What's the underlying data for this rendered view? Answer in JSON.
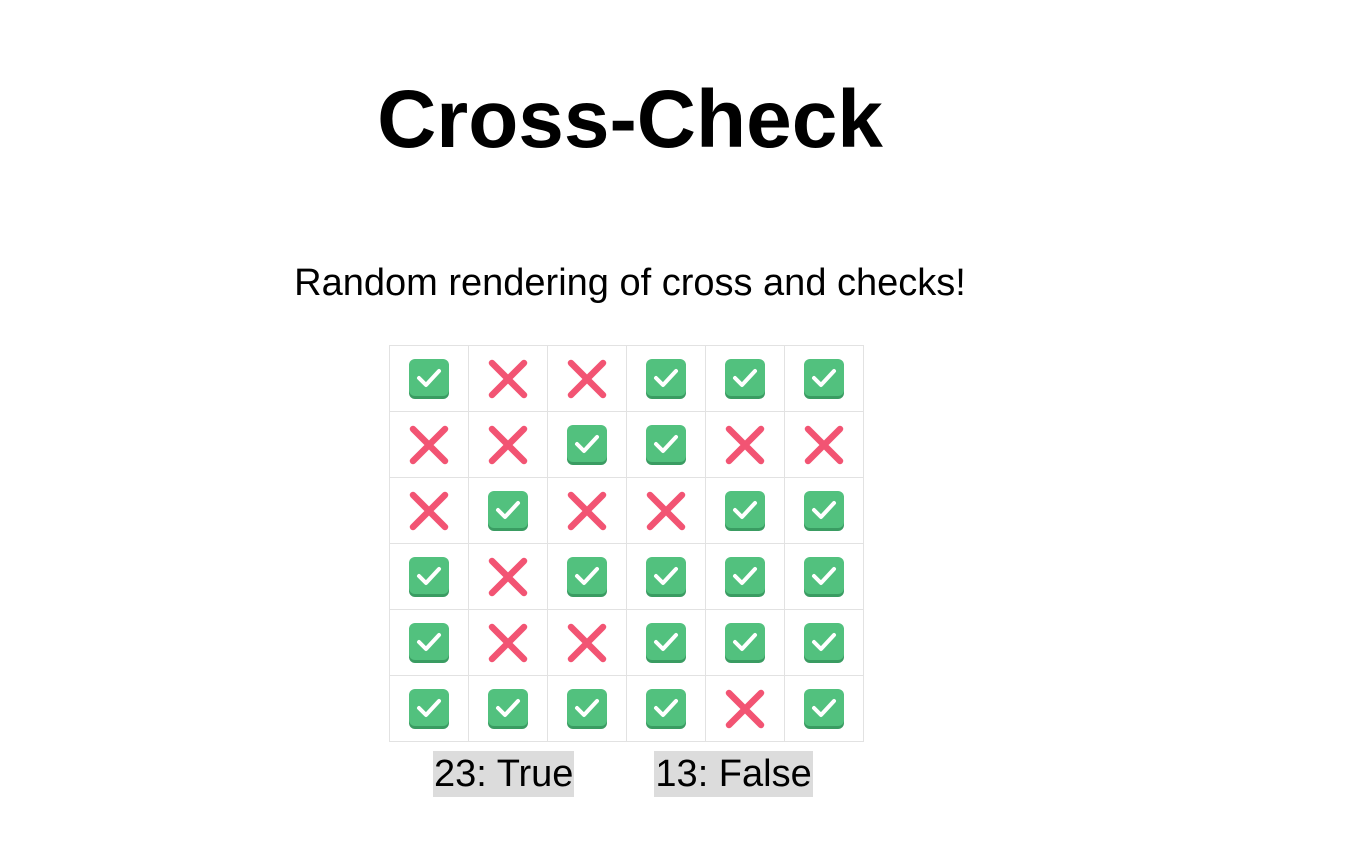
{
  "header": {
    "title": "Cross-Check",
    "subtitle": "Random rendering of cross and checks!"
  },
  "grid": {
    "rows": [
      [
        "check",
        "cross",
        "cross",
        "check",
        "check",
        "check"
      ],
      [
        "cross",
        "cross",
        "check",
        "check",
        "cross",
        "cross"
      ],
      [
        "cross",
        "check",
        "cross",
        "cross",
        "check",
        "check"
      ],
      [
        "check",
        "cross",
        "check",
        "check",
        "check",
        "check"
      ],
      [
        "check",
        "cross",
        "cross",
        "check",
        "check",
        "check"
      ],
      [
        "check",
        "check",
        "check",
        "check",
        "cross",
        "check"
      ]
    ]
  },
  "counts": {
    "true_label": "23: True",
    "false_label": "13: False"
  },
  "colors": {
    "check_fill": "#52c17e",
    "check_shadow": "#3a9c62",
    "cross_color": "#f25473",
    "cell_border": "#e2e2e2",
    "count_background": "#dcdcdc"
  }
}
